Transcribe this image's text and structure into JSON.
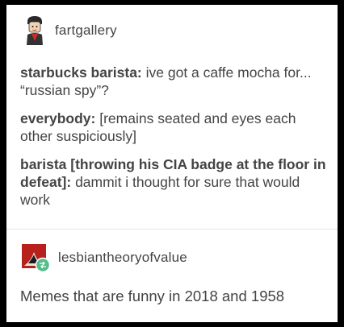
{
  "post": {
    "username": "fartgallery",
    "lines": [
      {
        "speaker": "starbucks barista:",
        "text": " ive got a caffe mocha for... “russian spy”?"
      },
      {
        "speaker": "everybody:",
        "text": " [remains seated and eyes each other suspiciously]"
      },
      {
        "speaker": "barista [throwing his CIA badge at the floor in defeat]:",
        "text": " dammit i thought for sure that would work"
      }
    ]
  },
  "reblog": {
    "username": "lesbiantheoryofvalue",
    "text": "Memes that are funny in 2018 and 1958",
    "reblog_badge_color": "#56bc8a"
  }
}
